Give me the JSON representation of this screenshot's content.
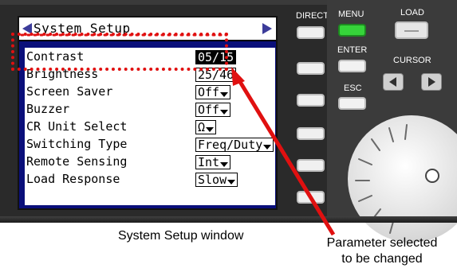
{
  "screen": {
    "title": "System Setup",
    "rows": [
      {
        "label": "Contrast",
        "value": "05/15",
        "selected": true,
        "dropdown": false
      },
      {
        "label": "Brightness",
        "value": "25/46",
        "selected": false,
        "dropdown": false
      },
      {
        "label": "Screen Saver",
        "value": "Off",
        "selected": false,
        "dropdown": true
      },
      {
        "label": "Buzzer",
        "value": "Off",
        "selected": false,
        "dropdown": true
      },
      {
        "label": "CR Unit Select",
        "value": "Ω",
        "selected": false,
        "dropdown": true
      },
      {
        "label": "Switching Type",
        "value": "Freq/Duty",
        "selected": false,
        "dropdown": true
      },
      {
        "label": "Remote Sensing",
        "value": "Int",
        "selected": false,
        "dropdown": true
      },
      {
        "label": "Load Response",
        "value": "Slow",
        "selected": false,
        "dropdown": true
      }
    ]
  },
  "buttons": {
    "direct_label": "DIRECT",
    "menu_label": "MENU",
    "load_label": "LOAD",
    "enter_label": "ENTER",
    "cursor_label": "CURSOR",
    "esc_label": "ESC"
  },
  "captions": {
    "window": "System Setup window",
    "param_line1": "Parameter selected",
    "param_line2": "to be changed"
  },
  "colors": {
    "screen_bg": "#0a0f7a",
    "highlight": "#e01010",
    "menu_led": "#36d43a"
  }
}
